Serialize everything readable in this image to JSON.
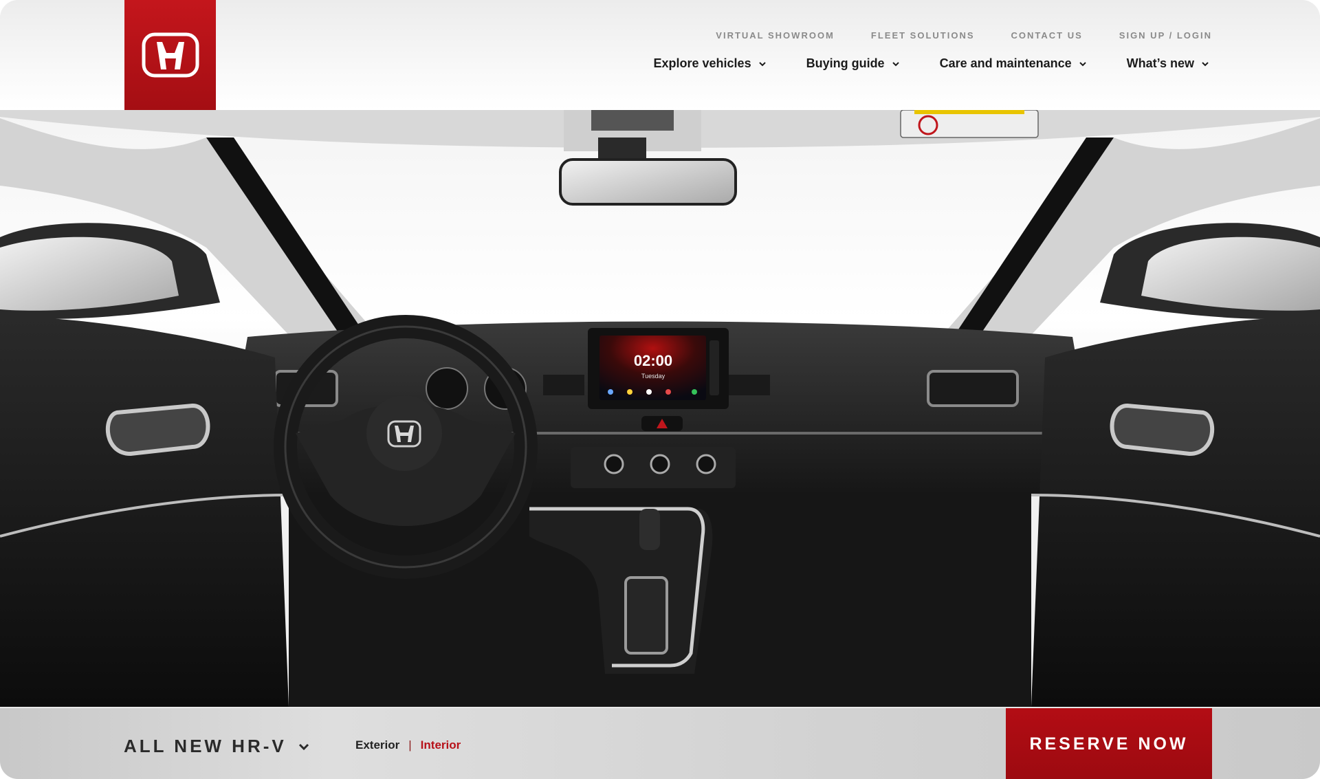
{
  "brand": {
    "logo_icon": "honda-h-logo-icon",
    "accent_color": "#b30d14"
  },
  "utility_nav": [
    {
      "label": "VIRTUAL SHOWROOM"
    },
    {
      "label": "FLEET SOLUTIONS"
    },
    {
      "label": "CONTACT US"
    },
    {
      "label": "SIGN UP / LOGIN"
    }
  ],
  "main_nav": [
    {
      "label": "Explore vehicles",
      "icon": "chevron-down-icon"
    },
    {
      "label": "Buying guide",
      "icon": "chevron-down-icon"
    },
    {
      "label": "Care and maintenance",
      "icon": "chevron-down-icon"
    },
    {
      "label": "What’s new",
      "icon": "chevron-down-icon"
    }
  ],
  "hero": {
    "infotainment": {
      "time": "02:00",
      "day": "Tuesday"
    }
  },
  "bottom_bar": {
    "model_name": "ALL NEW HR-V",
    "view_toggle": {
      "exterior_label": "Exterior",
      "separator": "|",
      "interior_label": "Interior",
      "active": "Interior"
    },
    "reserve_label": "RESERVE NOW"
  }
}
